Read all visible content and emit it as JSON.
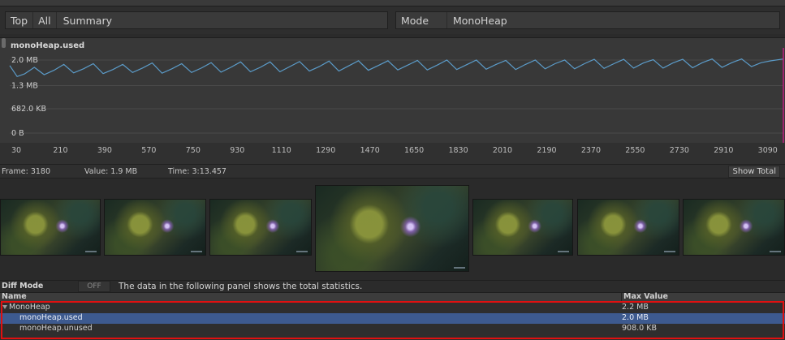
{
  "toolbar": {
    "left_segments": [
      "Top",
      "All"
    ],
    "summary_label": "Summary",
    "mode_label": "Mode",
    "mode_value": "MonoHeap"
  },
  "chart": {
    "title": "monoHeap.used",
    "line_color": "#5b9bc8",
    "marker_color": "#c02080"
  },
  "chart_data": {
    "type": "line",
    "title": "monoHeap.used",
    "y_tick_labels": [
      "2.0 MB",
      "1.3 MB",
      "682.0 KB",
      "0 B"
    ],
    "y_tick_values_mb": [
      2.0,
      1.3,
      0.666,
      0
    ],
    "ylim_mb": [
      0,
      2.0
    ],
    "x_tick_labels": [
      "30",
      "210",
      "390",
      "570",
      "750",
      "930",
      "1110",
      "1290",
      "1470",
      "1650",
      "1830",
      "2010",
      "2190",
      "2370",
      "2550",
      "2730",
      "2910",
      "3090"
    ],
    "xlim": [
      30,
      3180
    ],
    "grid": true,
    "series": [
      {
        "x": [
          30,
          60,
          90,
          130,
          170,
          210,
          250,
          290,
          330,
          370,
          410,
          450,
          490,
          530,
          570,
          610,
          650,
          690,
          730,
          770,
          810,
          850,
          890,
          930,
          970,
          1010,
          1050,
          1090,
          1130,
          1170,
          1210,
          1250,
          1290,
          1330,
          1370,
          1410,
          1450,
          1490,
          1530,
          1570,
          1610,
          1650,
          1690,
          1730,
          1770,
          1810,
          1850,
          1890,
          1930,
          1970,
          2010,
          2050,
          2090,
          2130,
          2170,
          2210,
          2250,
          2290,
          2330,
          2370,
          2410,
          2450,
          2490,
          2530,
          2570,
          2610,
          2650,
          2690,
          2730,
          2770,
          2810,
          2850,
          2890,
          2930,
          2970,
          3010,
          3050,
          3090,
          3130,
          3180
        ],
        "values": [
          1.85,
          1.55,
          1.62,
          1.8,
          1.6,
          1.72,
          1.88,
          1.65,
          1.76,
          1.9,
          1.63,
          1.74,
          1.88,
          1.66,
          1.78,
          1.92,
          1.64,
          1.76,
          1.9,
          1.66,
          1.78,
          1.93,
          1.67,
          1.8,
          1.95,
          1.68,
          1.8,
          1.95,
          1.68,
          1.82,
          1.96,
          1.7,
          1.82,
          1.97,
          1.7,
          1.84,
          1.98,
          1.72,
          1.85,
          1.98,
          1.73,
          1.86,
          1.99,
          1.73,
          1.86,
          2.0,
          1.74,
          1.87,
          2.0,
          1.75,
          1.88,
          1.99,
          1.74,
          1.88,
          2.0,
          1.76,
          1.9,
          2.0,
          1.76,
          1.9,
          2.02,
          1.77,
          1.9,
          2.02,
          1.78,
          1.92,
          2.01,
          1.78,
          1.92,
          2.02,
          1.79,
          1.93,
          2.03,
          1.8,
          1.93,
          2.03,
          1.82,
          1.93,
          1.98,
          2.03
        ]
      }
    ]
  },
  "info": {
    "frame": "Frame: 3180",
    "value": "Value: 1.9 MB",
    "time": "Time: 3:13.457",
    "show_total": "Show Total"
  },
  "details": {
    "diff_mode_label": "Diff Mode",
    "diff_toggle": "OFF",
    "message": "The data in the following panel shows the total statistics.",
    "col_name": "Name",
    "col_max": "Max Value",
    "rows": [
      {
        "name": "MonoHeap",
        "value": "2.2 MB"
      },
      {
        "name": "monoHeap.used",
        "value": "2.0 MB"
      },
      {
        "name": "monoHeap.unused",
        "value": "908.0 KB"
      }
    ]
  }
}
